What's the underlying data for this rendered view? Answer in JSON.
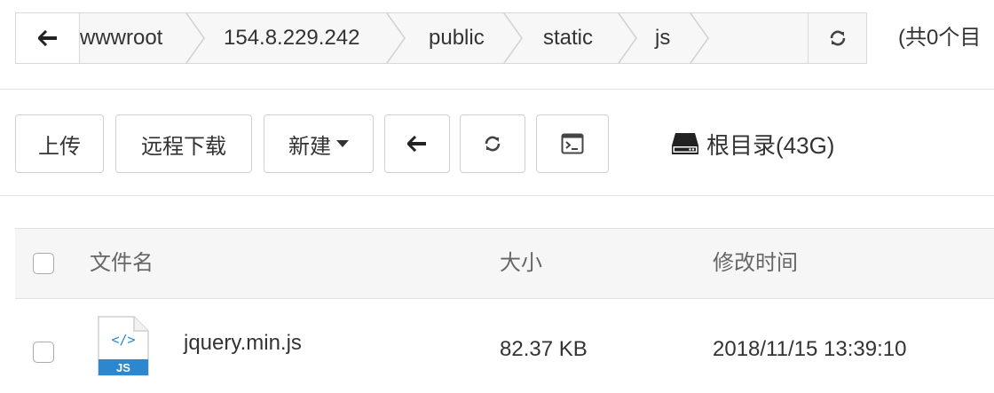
{
  "pathbar": {
    "crumbs": [
      "wwwroot",
      "154.8.229.242",
      "public",
      "static",
      "js"
    ],
    "count_text": "(共0个目"
  },
  "toolbar": {
    "upload": "上传",
    "remote_download": "远程下载",
    "new": "新建",
    "disk_label": "根目录(43G)"
  },
  "table": {
    "columns": {
      "name": "文件名",
      "size": "大小",
      "modified": "修改时间"
    },
    "rows": [
      {
        "name": "jquery.min.js",
        "size": "82.37 KB",
        "modified": "2018/11/15 13:39:10",
        "icon_badge": "JS",
        "icon_glyph": "</>"
      }
    ]
  },
  "colors": {
    "border": "#d8d8d8",
    "header_bg": "#f6f6f6",
    "js_icon_blue": "#2a87d0"
  }
}
